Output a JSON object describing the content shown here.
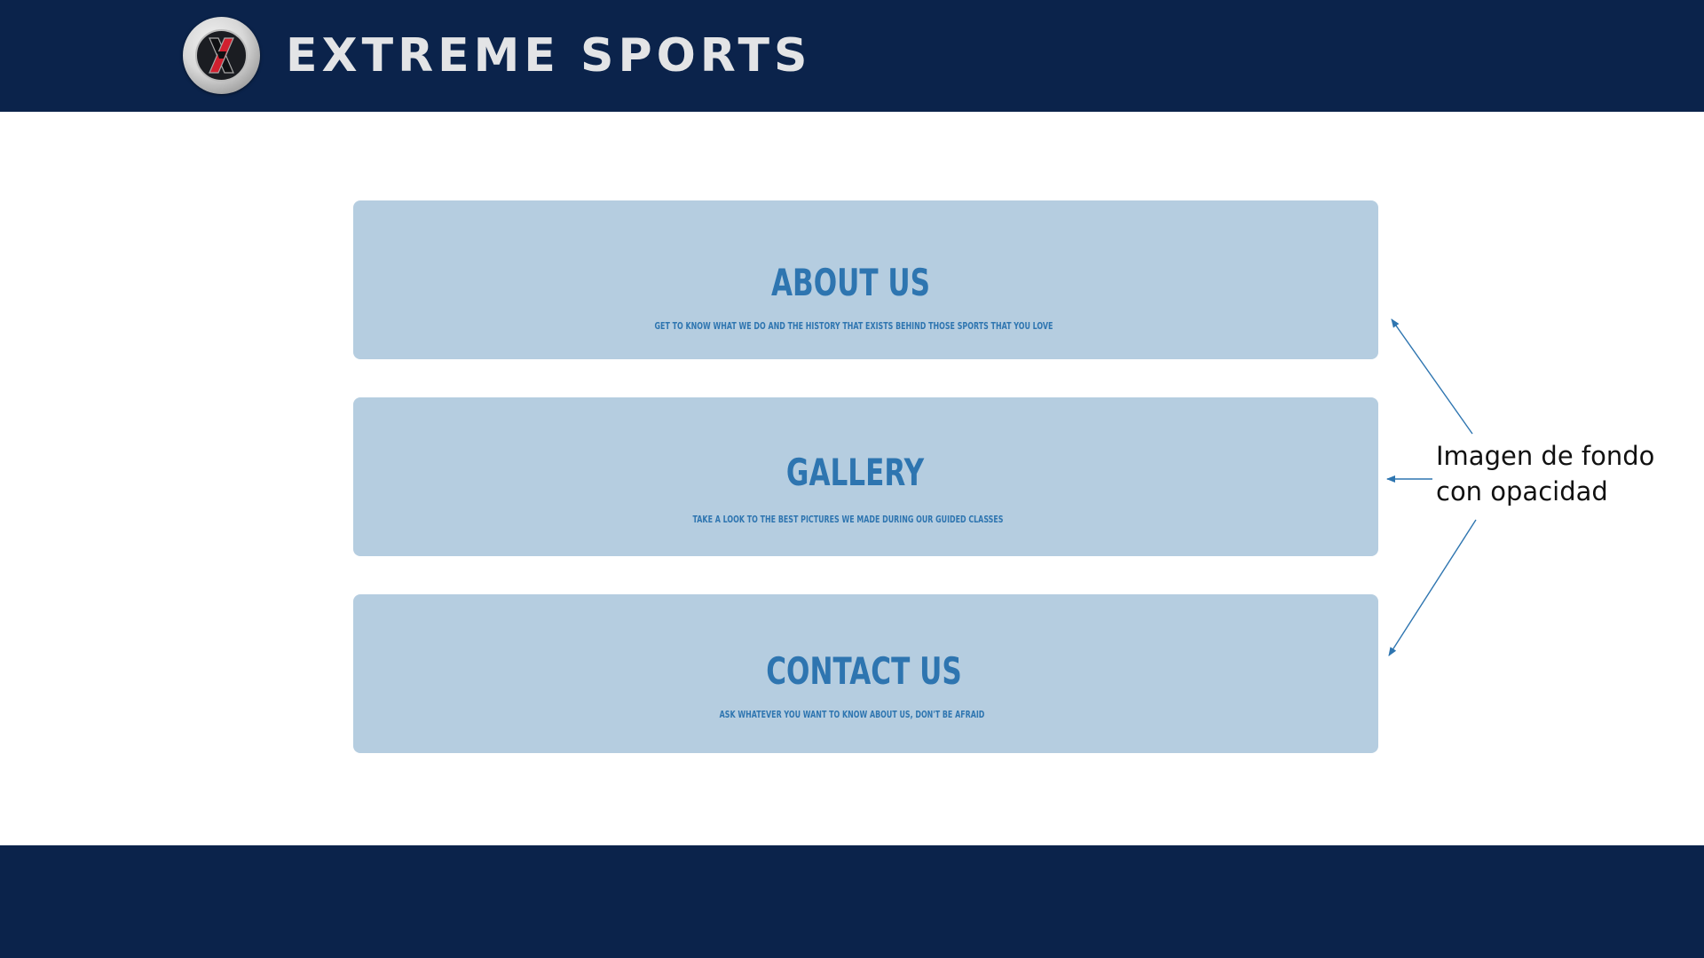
{
  "header": {
    "brand_title": "EXTREME SPORTS",
    "logo_letter": "X",
    "colors": {
      "bar": "#0b234b",
      "title": "#e3e4e6",
      "logo_x_red": "#d2202f",
      "logo_x_dark": "#1b1d22"
    }
  },
  "cards": [
    {
      "title": "ABOUT US",
      "subtitle": "GET TO KNOW WHAT WE DO AND THE HISTORY THAT EXISTS BEHIND THOSE SPORTS THAT YOU LOVE"
    },
    {
      "title": "GALLERY",
      "subtitle": "TAKE A LOOK TO THE BEST PICTURES WE MADE DURING OUR GUIDED CLASSES"
    },
    {
      "title": "CONTACT US",
      "subtitle": "ASK WHATEVER YOU WANT TO KNOW ABOUT US, DON'T BE AFRAID"
    }
  ],
  "annotation": {
    "line1": "Imagen de fondo",
    "line2": "con opacidad",
    "arrow_color": "#2e75b0"
  },
  "colors": {
    "card_background": "#b5cde0",
    "card_text": "#2e75b0",
    "footer": "#0b234b"
  }
}
